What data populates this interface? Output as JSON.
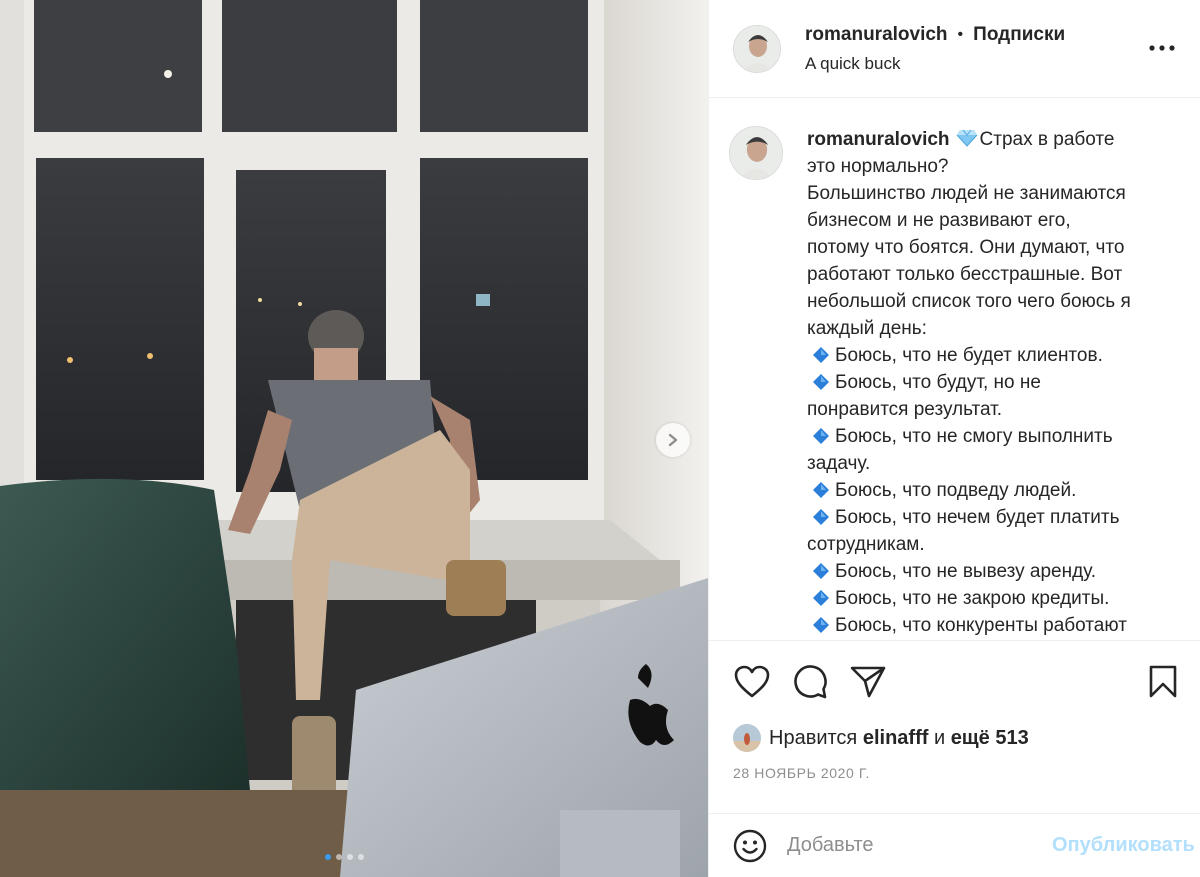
{
  "post": {
    "username": "romanuralovich",
    "separator": "•",
    "follow_label": "Подписки",
    "location": "A quick buck",
    "more_icon": "more-horizontal-icon"
  },
  "photo": {
    "alt": "Man in grey t-shirt and beige sweatpants sitting on a window sill in an office",
    "next_icon": "chevron-right-icon",
    "carousel": {
      "count": 4,
      "active": 1
    }
  },
  "caption": {
    "username": "romanuralovich",
    "lines": [
      "Страх в работе",
      "это нормально?",
      "Большинство людей не занимаются",
      "бизнесом и не развивают его,",
      "потому что боятся. Они думают, что",
      "работают только бесстрашные. Вот",
      "небольшой список того чего боюсь я",
      "каждый день:",
      "Боюсь, что не будет клиентов.",
      "Боюсь, что будут, но не",
      "понравится результат.",
      "Боюсь, что не смогу выполнить",
      "задачу.",
      "Боюсь, что подведу людей.",
      "Боюсь, что нечем будет платить",
      "сотрудникам.",
      "Боюсь, что не вывезу аренду.",
      "Боюсь, что не закрою кредиты.",
      "Боюсь, что конкуренты работают"
    ]
  },
  "actions": {
    "like_icon": "heart-icon",
    "comment_icon": "comment-icon",
    "share_icon": "paper-plane-icon",
    "save_icon": "bookmark-icon"
  },
  "likes": {
    "prefix": "Нравится",
    "user": "elinafff",
    "conj": "и",
    "others": "ещё 513"
  },
  "date": "28 НОЯБРЬ 2020 Г.",
  "comment": {
    "emoji_icon": "smiley-icon",
    "placeholder": "Добавьте",
    "publish_label": "Опубликовать"
  },
  "colors": {
    "text": "#262626",
    "muted": "#8e8e8e",
    "border": "#efefef",
    "publish_disabled": "#b2dffc",
    "carousel_active": "#3b9bf0"
  }
}
